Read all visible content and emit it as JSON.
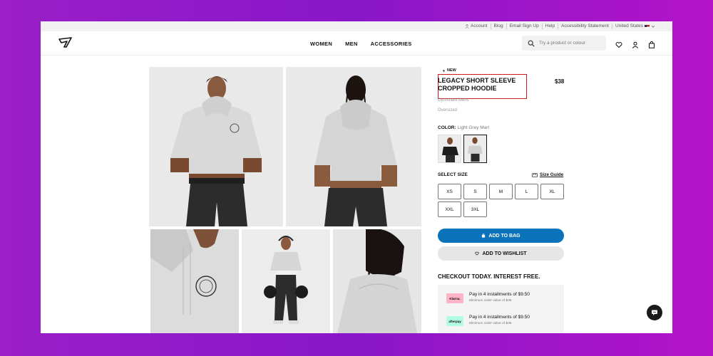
{
  "utility_bar": {
    "account": "Account",
    "blog": "Blog",
    "email_signup": "Email Sign Up",
    "help": "Help",
    "accessibility": "Accessibility Statement",
    "region": "United States"
  },
  "header": {
    "nav": [
      "WOMEN",
      "MEN",
      "ACCESSORIES"
    ],
    "search_placeholder": "Try a product or colour"
  },
  "product": {
    "badge": "NEW",
    "title_line1": "LEGACY SHORT SLEEVE",
    "title_line2": "CROPPED HOODIE",
    "price": "$38",
    "brand": "Gymshark Mens",
    "fit": "Oversized",
    "color_label": "COLOR:",
    "color_value": "Light Grey Marl",
    "select_size": "SELECT SIZE",
    "size_guide": "Size Guide",
    "sizes": [
      "XS",
      "S",
      "M",
      "L",
      "XL",
      "XXL",
      "3XL"
    ],
    "add_to_bag": "ADD TO BAG",
    "add_to_wishlist": "ADD TO WISHLIST"
  },
  "payment": {
    "heading": "CHECKOUT TODAY. INTEREST FREE.",
    "klarna_logo": "Klarna.",
    "klarna_text": "Pay in 4 installments of $9.50",
    "klarna_min": "Minimum order value of $35",
    "afterpay_logo": "afterpay",
    "afterpay_text": "Pay in 4 installments of $9.50",
    "afterpay_min": "Minimum order value of $35"
  },
  "colors": {
    "accent_blue": "#0a73ba",
    "highlight_red": "#cc1b1b",
    "klarna_pink": "#ffb3c7",
    "afterpay_mint": "#b2fce4"
  }
}
